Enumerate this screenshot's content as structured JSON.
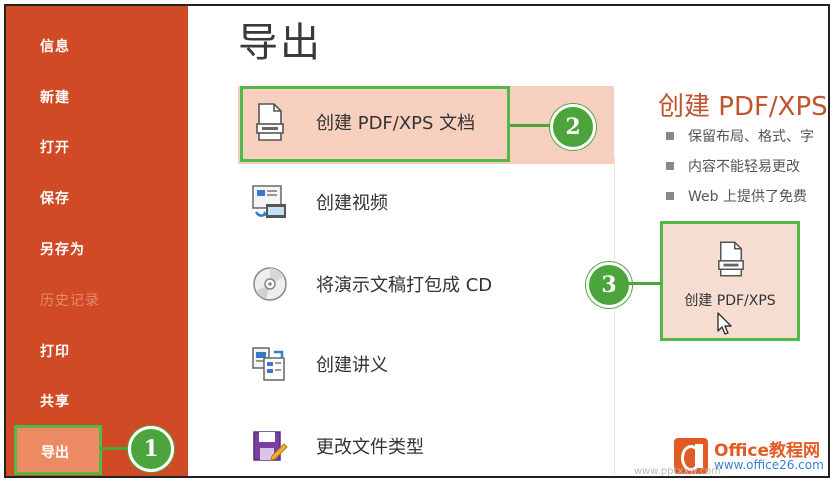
{
  "sidebar": {
    "items": [
      {
        "label": "信息"
      },
      {
        "label": "新建"
      },
      {
        "label": "打开"
      },
      {
        "label": "保存"
      },
      {
        "label": "另存为"
      },
      {
        "label": "历史记录"
      },
      {
        "label": "打印"
      },
      {
        "label": "共享"
      }
    ],
    "selected_label": "导出"
  },
  "main": {
    "title": "导出",
    "options": [
      {
        "label": "创建 PDF/XPS 文档",
        "icon": "pdf-document-icon"
      },
      {
        "label": "创建视频",
        "icon": "video-icon"
      },
      {
        "label": "将演示文稿打包成 CD",
        "icon": "cd-icon"
      },
      {
        "label": "创建讲义",
        "icon": "handout-icon"
      },
      {
        "label": "更改文件类型",
        "icon": "file-type-icon"
      }
    ]
  },
  "right_pane": {
    "title": "创建 PDF/XPS",
    "bullets": [
      "保留布局、格式、字",
      "内容不能轻易更改",
      "Web 上提供了免费"
    ],
    "button_label": "创建 PDF/XPS"
  },
  "callouts": [
    "1",
    "2",
    "3"
  ],
  "watermark": {
    "brand": "Office教程网",
    "url": "www.office26.com",
    "sub": "www.pptxxw.com"
  },
  "colors": {
    "sidebar": "#d04a26",
    "accent": "#c0542f",
    "highlight": "#52b848"
  }
}
